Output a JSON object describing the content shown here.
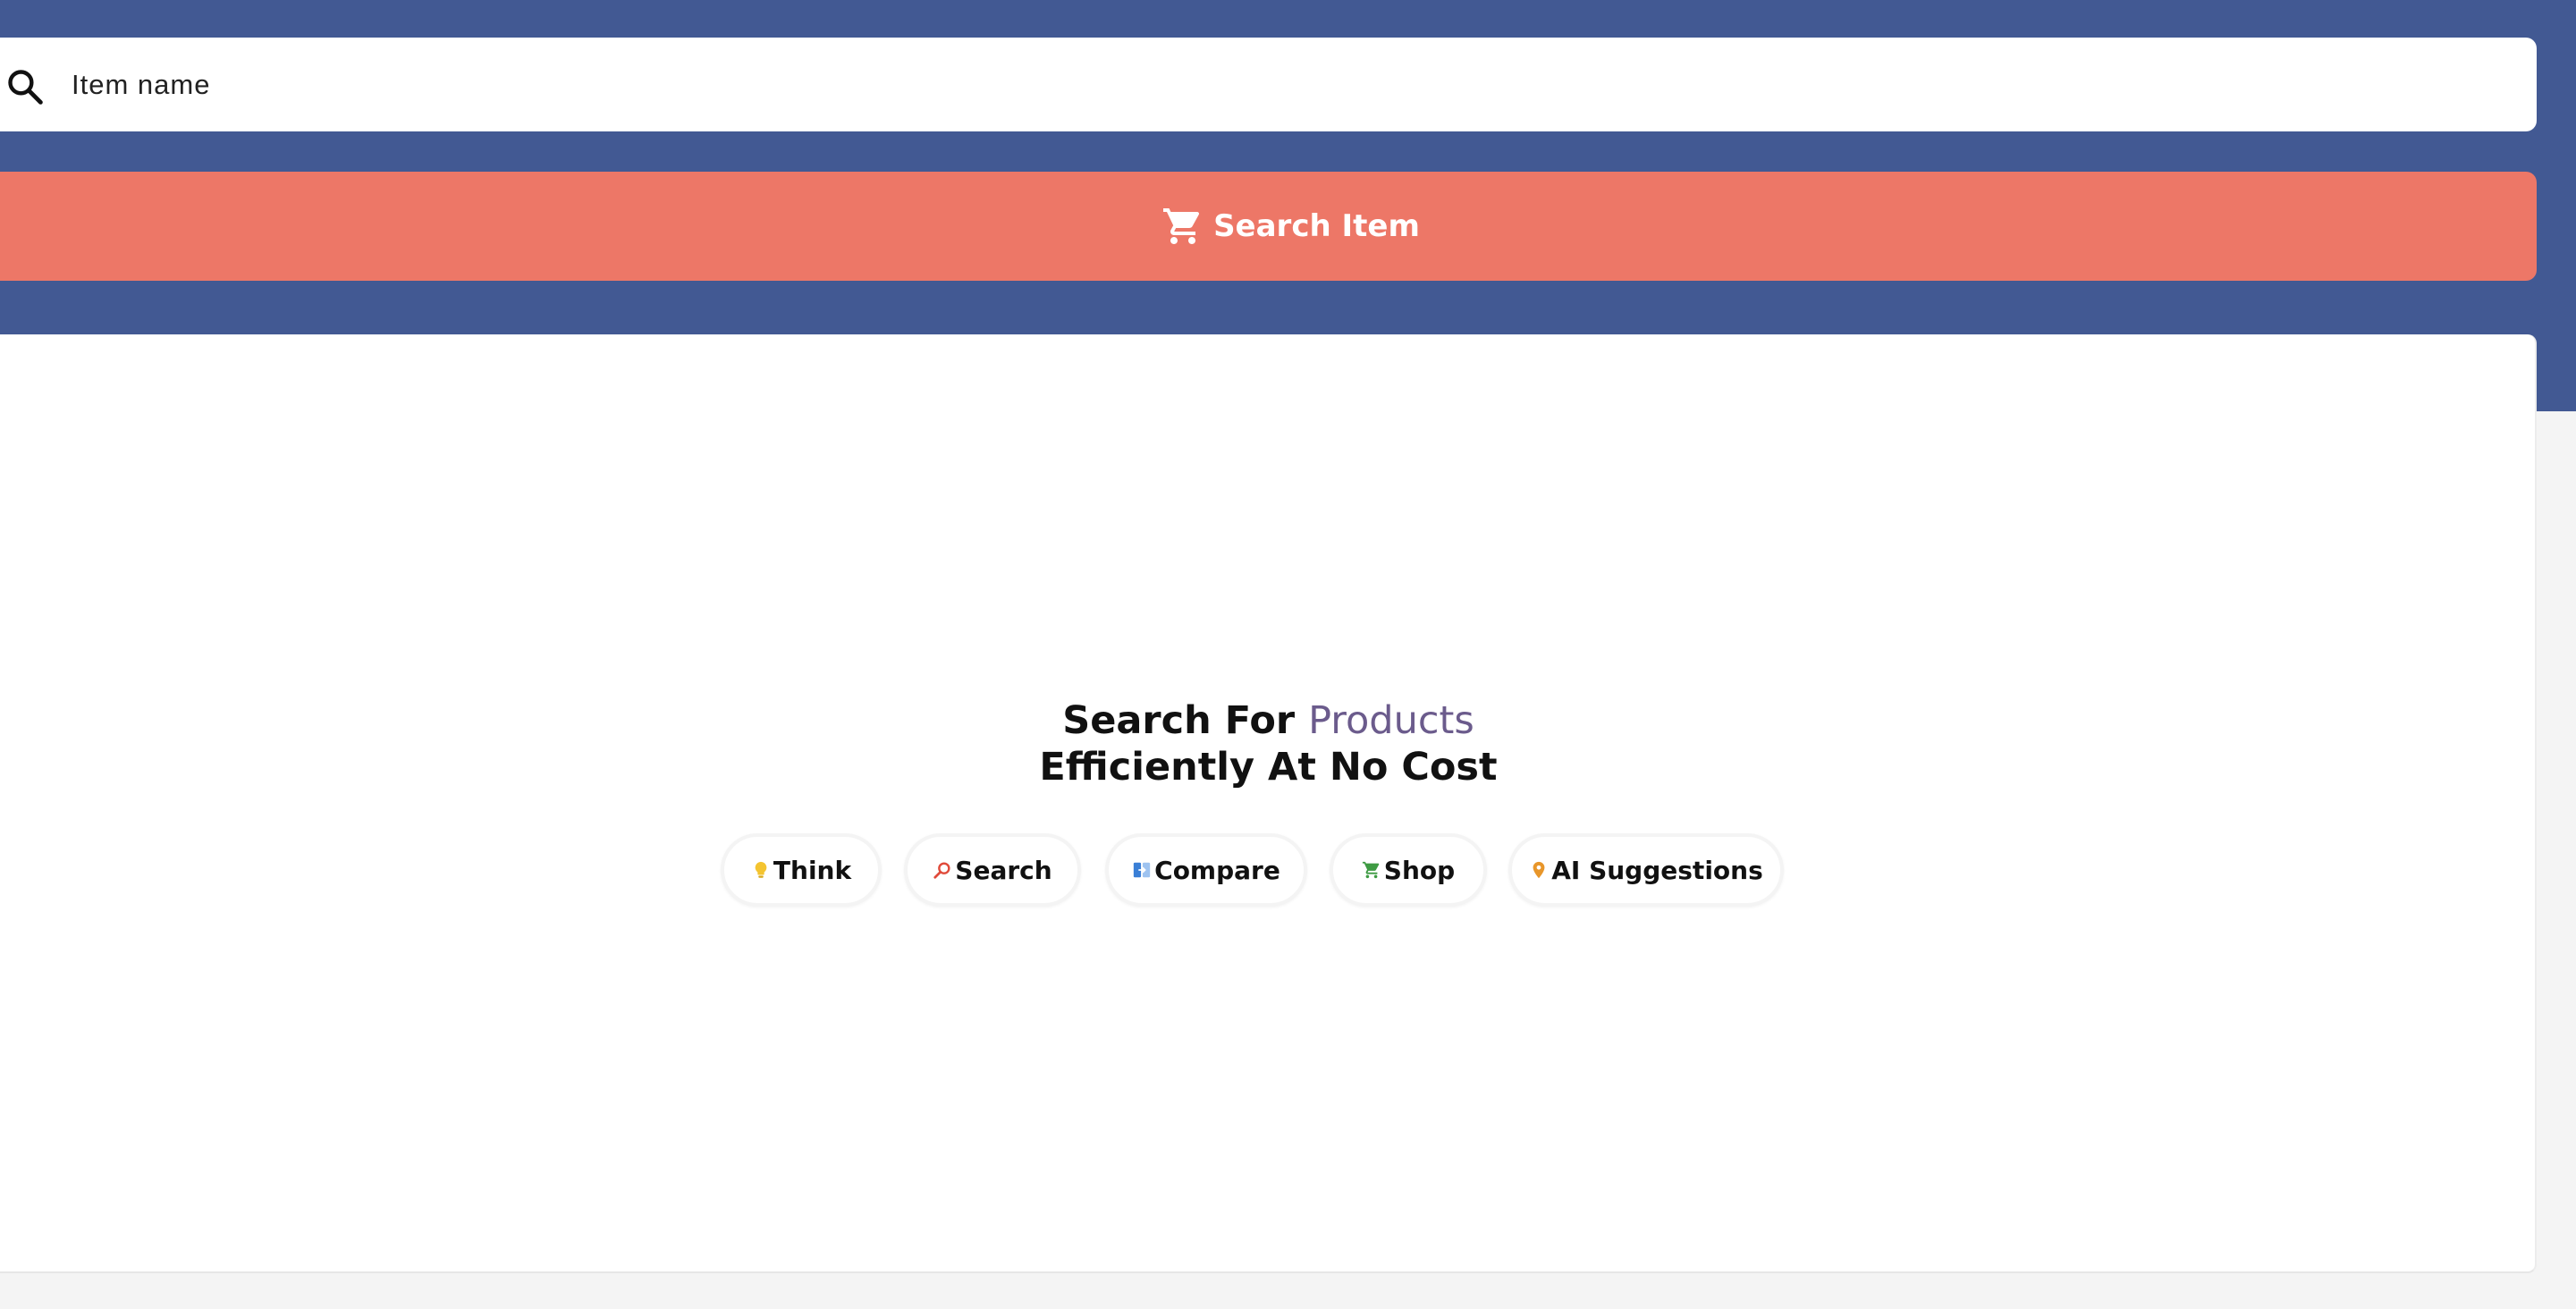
{
  "search": {
    "placeholder": "Item name",
    "button_label": "Search Item"
  },
  "hero": {
    "line1_prefix": "Search For",
    "line1_accent": "Products",
    "line2": "Efficiently At No Cost"
  },
  "chips": [
    {
      "label": "Think",
      "icon": "lightbulb-icon",
      "color": "#f4c430"
    },
    {
      "label": "Search",
      "icon": "magnifier-icon",
      "color": "#e04a3a"
    },
    {
      "label": "Compare",
      "icon": "compare-icon",
      "color": "#3a7fd6"
    },
    {
      "label": "Shop",
      "icon": "cart-icon",
      "color": "#3e9b43"
    },
    {
      "label": "AI Suggestions",
      "icon": "location-pin-icon",
      "color": "#e8962a"
    }
  ],
  "colors": {
    "header_bg": "#425993",
    "button_bg": "#ed7767",
    "accent_text": "#6b5b8c",
    "page_bg": "#f4f4f4"
  }
}
